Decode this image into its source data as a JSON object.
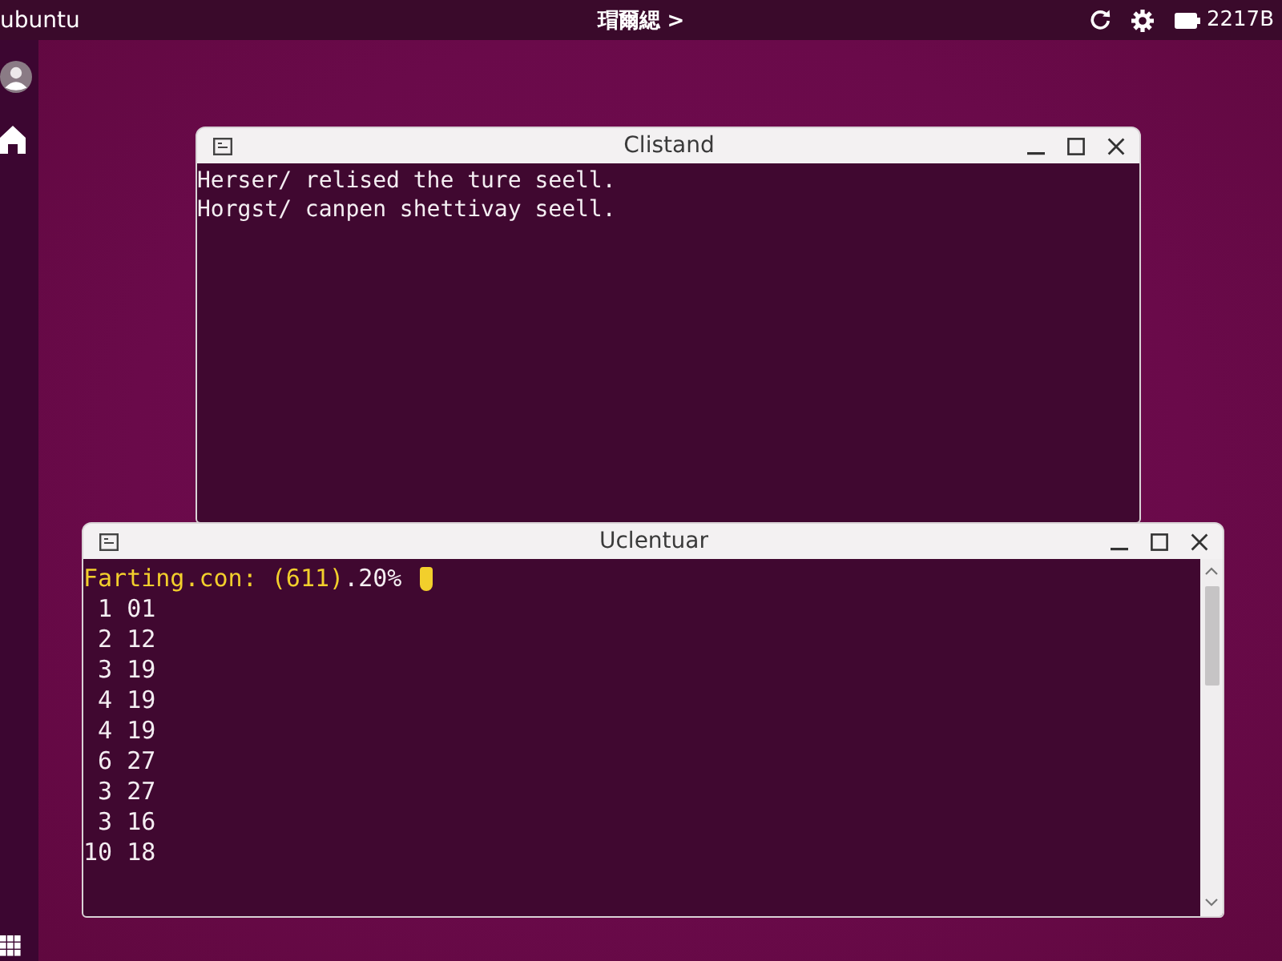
{
  "top_bar": {
    "os_label": "ubuntu",
    "app_menu": "瑁爾緦 >",
    "clock": "2217B"
  },
  "windows": [
    {
      "title": "Clistand",
      "scrollbar": false,
      "lines": [
        "Herser/ relised the ture seell.",
        "Horgst/ canpen shettivay seell."
      ]
    },
    {
      "title": "Uclentuar",
      "scrollbar": true,
      "prompt": {
        "highlighted": "Farting.con: (611)",
        "rest": ".20%"
      },
      "rows": [
        {
          "column_1": "1",
          "column_2": "01"
        },
        {
          "column_1": "2",
          "column_2": "12"
        },
        {
          "column_1": "3",
          "column_2": "19"
        },
        {
          "column_1": "4",
          "column_2": "19"
        },
        {
          "column_1": "4",
          "column_2": "19"
        },
        {
          "column_1": "6",
          "column_2": "27"
        },
        {
          "column_1": "3",
          "column_2": "27"
        },
        {
          "column_1": "3",
          "column_2": "16"
        },
        {
          "column_1": "10",
          "column_2": "18"
        }
      ]
    }
  ]
}
